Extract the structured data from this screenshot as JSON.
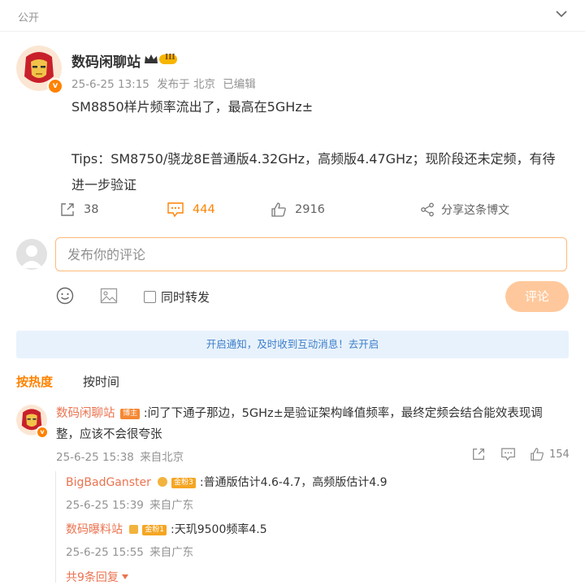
{
  "visibility": {
    "label": "公开"
  },
  "post": {
    "author": "数码闲聊站",
    "level_badge": "III",
    "date": "25-6-25 13:15",
    "location": "发布于 北京",
    "edited": "已编辑",
    "line1": "SM8850样片频率流出了，最高在5GHz±",
    "line2": "Tips：SM8750/骁龙8E普通版4.32GHz，高频版4.47GHz；现阶段还未定频，有待",
    "line3": "进一步验证",
    "reposts": "38",
    "comments": "444",
    "likes": "2916",
    "share_label": "分享这条博文"
  },
  "composer": {
    "placeholder": "发布你的评论",
    "repost_label": "同时转发",
    "submit_label": "评论"
  },
  "notice": {
    "text": "开启通知，及时收到互动消息！去开启"
  },
  "sort": {
    "hot": "按热度",
    "time": "按时间"
  },
  "comment": {
    "author": "数码闲聊站",
    "tag": "博主",
    "text_line1": ":问了下通子那边，5GHz±是验证架构峰值频率，最终定频会结合能效表现调",
    "text_line2": "整，应该不会很夸张",
    "date": "25-6-25 15:38",
    "location": "来自北京",
    "likes": "154"
  },
  "replies": [
    {
      "author": "BigBadGanster",
      "tag": "金粉3",
      "text": ":普通版估计4.6-4.7，高频版估计4.9",
      "date": "25-6-25 15:39",
      "location": "来自广东"
    },
    {
      "author": "数码曝料站",
      "tag": "金粉1",
      "text": ":天玑9500频率4.5",
      "date": "25-6-25 15:55",
      "location": "来自广东"
    }
  ],
  "more_replies": "共9条回复",
  "colors": {
    "accent": "#ff8200",
    "link": "#eb7350",
    "notice_bg": "#e8f2fd"
  }
}
